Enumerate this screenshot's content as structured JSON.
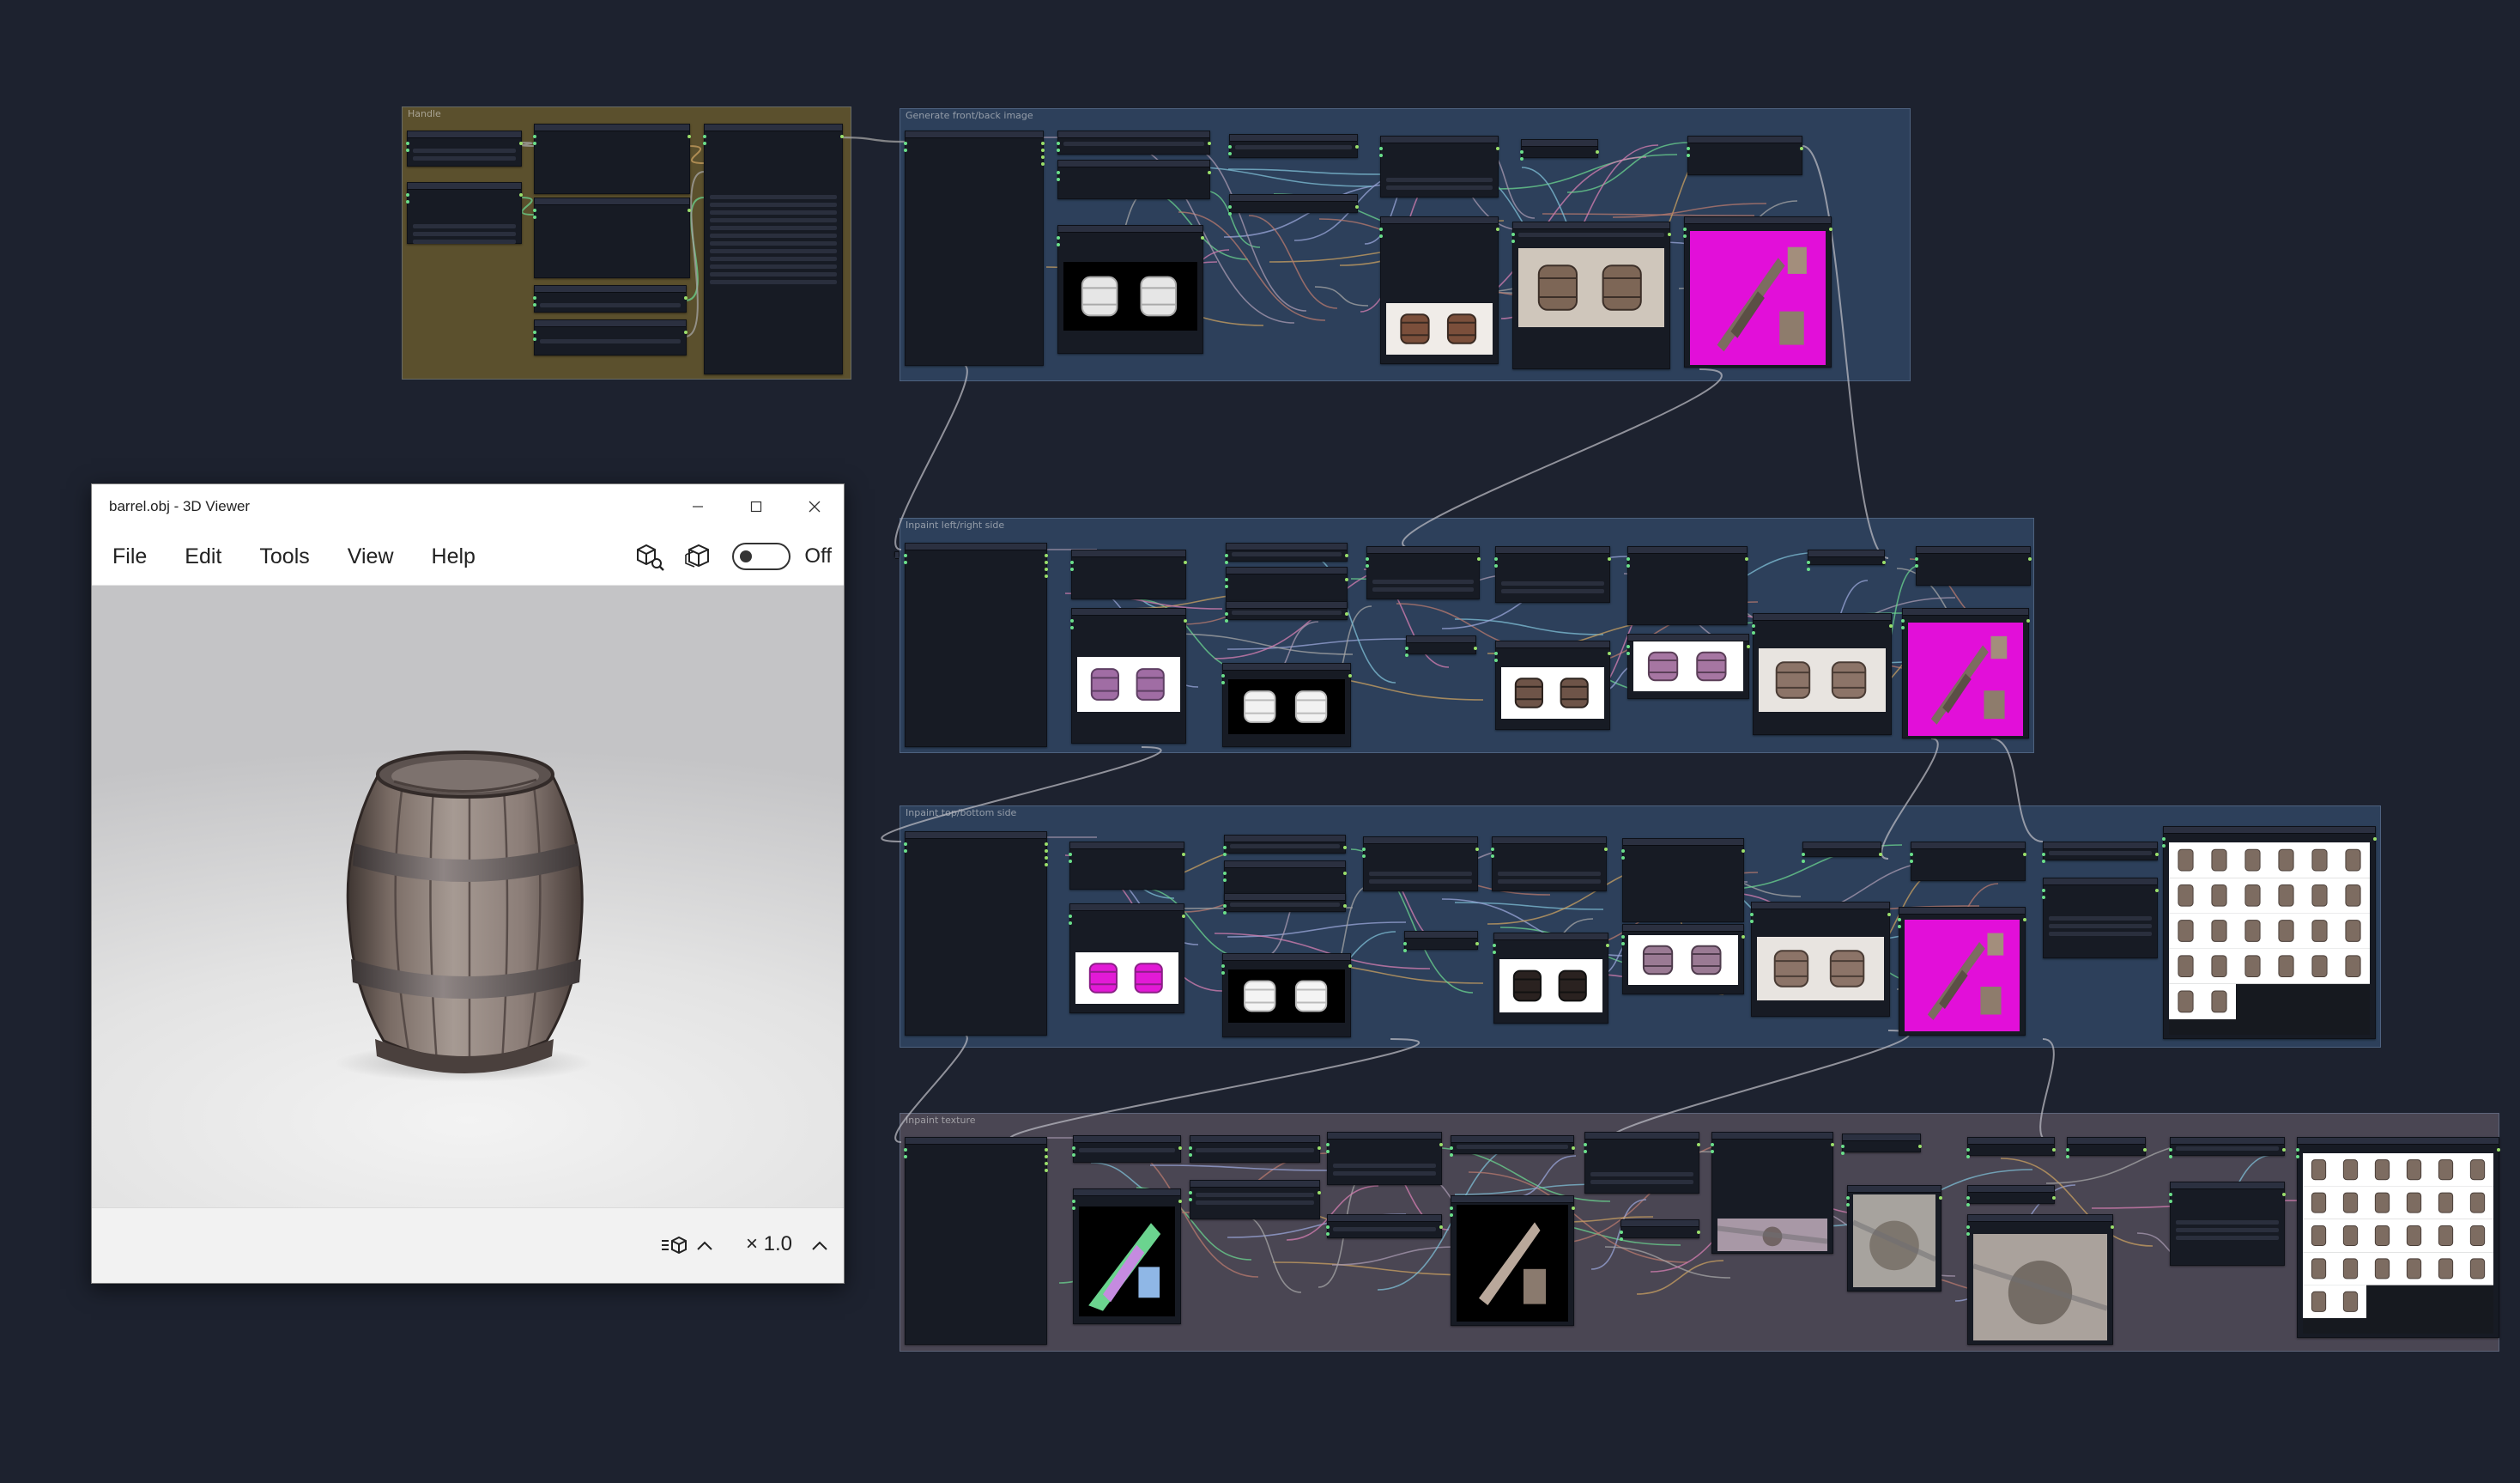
{
  "canvas": {
    "background": "#1d222f",
    "groups": [
      {
        "name": "Handle",
        "color": "#574a2b"
      },
      {
        "name": "Generate front/back image",
        "color": "#2b3d55"
      },
      {
        "name": "Inpaint left/right side",
        "color": "#2b3d55"
      },
      {
        "name": "Inpaint top/bottom side",
        "color": "#2b3d55"
      },
      {
        "name": "Inpaint texture",
        "color": "#4a4650"
      }
    ]
  },
  "viewer": {
    "title": "barrel.obj - 3D Viewer",
    "window_buttons": {
      "minimize": "—",
      "maximize": "☐",
      "close": "✕"
    },
    "menu": [
      "File",
      "Edit",
      "Tools",
      "View",
      "Help"
    ],
    "toolbar_icons": [
      "3d-object-search-icon",
      "3d-wireframe-icon"
    ],
    "toggle": {
      "state": "off",
      "label": "Off"
    },
    "status": {
      "zoom": "× 1.0"
    }
  }
}
